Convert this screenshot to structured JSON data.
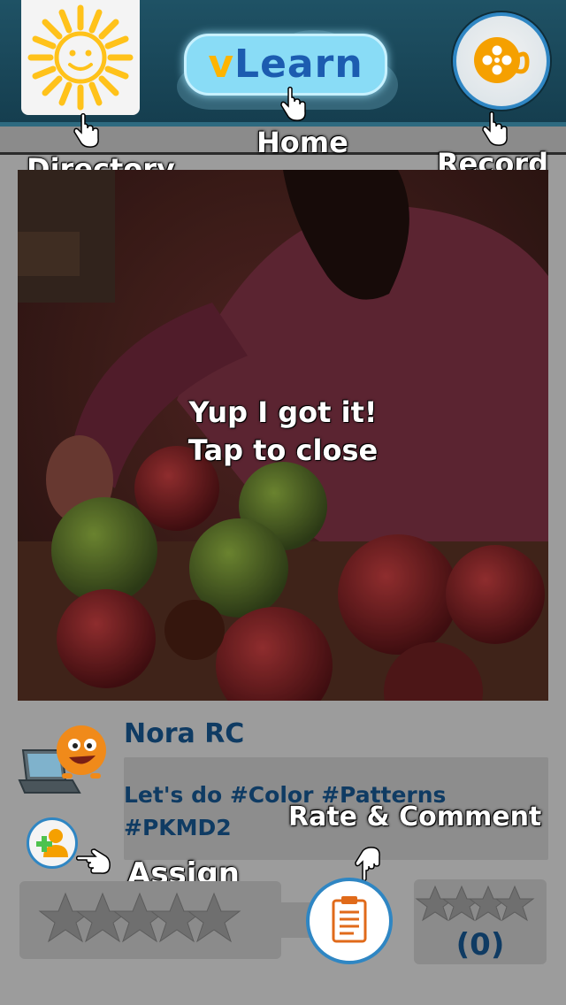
{
  "header": {
    "logo_prefix": "v",
    "logo_text": "Learn"
  },
  "hints": {
    "directory": "Directory",
    "home": "Home",
    "record": "Record",
    "assign": "Assign",
    "rate_comment": "Rate & Comment"
  },
  "overlay": {
    "line1": "Yup I got it!",
    "line2": "Tap to close"
  },
  "post": {
    "user_name": "Nora RC",
    "caption_line1": "Let's do #Color #Patterns",
    "caption_line2": "#PKMD2",
    "rating_count": "(0)"
  },
  "colors": {
    "header_bg": "#1a4759",
    "accent_blue": "#2f86c3",
    "text_navy": "#0f3b63",
    "sun_yellow": "#ffc21a",
    "reel_orange": "#f5a000"
  },
  "icons": {
    "directory": "sun-icon",
    "record": "film-reel-icon",
    "assign": "add-user-icon",
    "comment": "clipboard-icon",
    "hint_pointer": "pointing-hand-icon",
    "user_avatar": "laptop-smiley-avatar"
  }
}
